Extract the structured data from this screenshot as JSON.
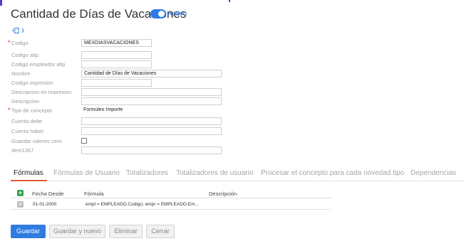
{
  "header": {
    "title": "Cantidad de Días de Vacaciones",
    "active_label": "Activo",
    "tags_icon": "tag-icon"
  },
  "fields": [
    {
      "label": "Codigo",
      "required": true,
      "value": "MEXDIASVACACIONES"
    },
    {
      "label": "Codigo afip",
      "required": false,
      "value": ""
    },
    {
      "label": "Codigo empleador afip",
      "required": false,
      "value": ""
    },
    {
      "label": "Nombre",
      "required": false,
      "value": "Cantidad de Días de Vacaciones"
    },
    {
      "label": "Codigo impresion",
      "required": false,
      "value": ""
    },
    {
      "label": "Descripcion en impresion",
      "required": false,
      "value": ""
    },
    {
      "label": "Descripcion",
      "required": false,
      "value": ""
    },
    {
      "label": "Tipo de concepto",
      "required": true,
      "value": "Formuleo Importe"
    },
    {
      "label": "Cuenta debe",
      "required": false,
      "value": ""
    },
    {
      "label": "Cuenta haber",
      "required": false,
      "value": ""
    },
    {
      "label": "Guardar valores cero",
      "required": false,
      "value": "",
      "checked": false
    },
    {
      "label": "Item1367",
      "required": false,
      "value": ""
    }
  ],
  "tabs": [
    {
      "label": "Fórmulas",
      "active": true
    },
    {
      "label": "Fórmulas de Usuario",
      "active": false
    },
    {
      "label": "Totalizadores",
      "active": false
    },
    {
      "label": "Totalizadores de usuario",
      "active": false
    },
    {
      "label": "Procesar el concepto para cada novedad tipo",
      "active": false
    },
    {
      "label": "Dependencias",
      "active": false
    }
  ],
  "grid": {
    "columns": [
      "Fecha Desde",
      "Fórmula",
      "Descripción"
    ],
    "rows": [
      {
        "fecha_desde": "01-01-2000",
        "formula": "empl = EMPLEADO.Codigo; empr = EMPLEADO.Em...",
        "descripcion": ""
      }
    ]
  },
  "actions": {
    "save": "Guardar",
    "save_new": "Guardar y nuevo",
    "delete": "Eliminar",
    "close": "Cerrar"
  },
  "colors": {
    "accent": "#2d7be6",
    "required": "#d9302c",
    "tab_underline": "#e25b33",
    "add": "#2fa54b"
  }
}
